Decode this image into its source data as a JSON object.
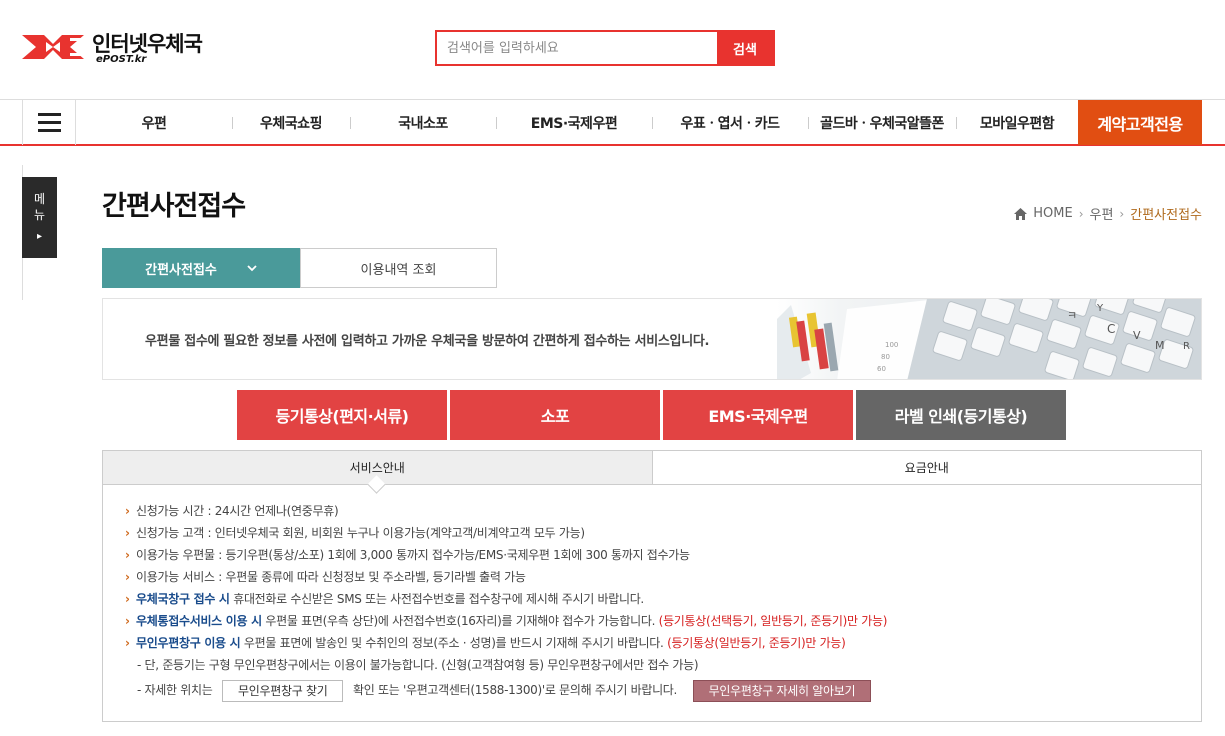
{
  "header": {
    "logo_title": "인터넷우체국",
    "logo_sub": "ePOST.kr",
    "search_placeholder": "검색어를 입력하세요",
    "search_button": "검색"
  },
  "gnb": {
    "items": [
      "우편",
      "우체국쇼핑",
      "국내소포",
      "EMS·국제우편",
      "우표ㆍ엽서ㆍ카드",
      "골드바ㆍ우체국알뜰폰",
      "모바일우편함"
    ],
    "special": "계약고객전용"
  },
  "side_menu": {
    "label_1": "메",
    "label_2": "뉴",
    "arrow": "▸"
  },
  "page": {
    "title": "간편사전접수",
    "breadcrumb": {
      "home": "HOME",
      "level1": "우편",
      "current": "간편사전접수"
    }
  },
  "subtabs": {
    "active": "간편사전접수",
    "other": "이용내역 조회"
  },
  "banner": {
    "text": "우편물 접수에 필요한 정보를 사전에 입력하고 가까운 우체국을 방문하여 간편하게 접수하는 서비스입니다."
  },
  "service_buttons": [
    "등기통상(편지·서류)",
    "소포",
    "EMS·국제우편",
    "라벨 인쇄(등기통상)"
  ],
  "info_tabs": {
    "active": "서비스안내",
    "other": "요금안내"
  },
  "info": {
    "line1": "신청가능 시간 : 24시간 언제나(연중무휴)",
    "line2": "신청가능 고객 : 인터넷우체국 회원, 비회원 누구나 이용가능(계약고객/비계약고객 모두 가능)",
    "line3": "이용가능 우편물 : 등기우편(통상/소포) 1회에 3,000 통까지 접수가능/EMS·국제우편 1회에 300 통까지 접수가능",
    "line4": "이용가능 서비스 : 우편물 종류에 따라 신청정보 및 주소라벨, 등기라벨 출력 가능",
    "line5_strong": "우체국창구 접수 시",
    "line5_rest": " 휴대전화로 수신받은 SMS 또는 사전접수번호를 접수창구에 제시해 주시기 바랍니다.",
    "line6_strong": "우체통접수서비스 이용 시",
    "line6_rest": " 우편물 표면(우측 상단)에 사전접수번호(16자리)를 기재해야 접수가 가능합니다.",
    "line6_red": " (등기통상(선택등기, 일반등기, 준등기)만 가능)",
    "line7_strong": "무인우편창구 이용 시",
    "line7_rest": " 우편물 표면에 발송인 및 수취인의 정보(주소 · 성명)를 반드시 기재해 주시기 바랍니다.",
    "line7_red": " (등기통상(일반등기, 준등기)만 가능)",
    "line8": "- 단, 준등기는 구형 무인우편창구에서는 이용이 불가능합니다. (신형(고객참여형 등) 무인우편창구에서만 접수 가능)",
    "line9_prefix": "- 자세한 위치는",
    "line9_button": "무인우편창구 찾기",
    "line9_suffix": "확인 또는 '우편고객센터(1588-1300)'로 문의해 주시기 바랍니다.",
    "detail_button": "무인우편창구 자세히 알아보기"
  },
  "colors": {
    "accent_red": "#e24343",
    "teal": "#4a9a9a",
    "orange": "#e14e12"
  }
}
